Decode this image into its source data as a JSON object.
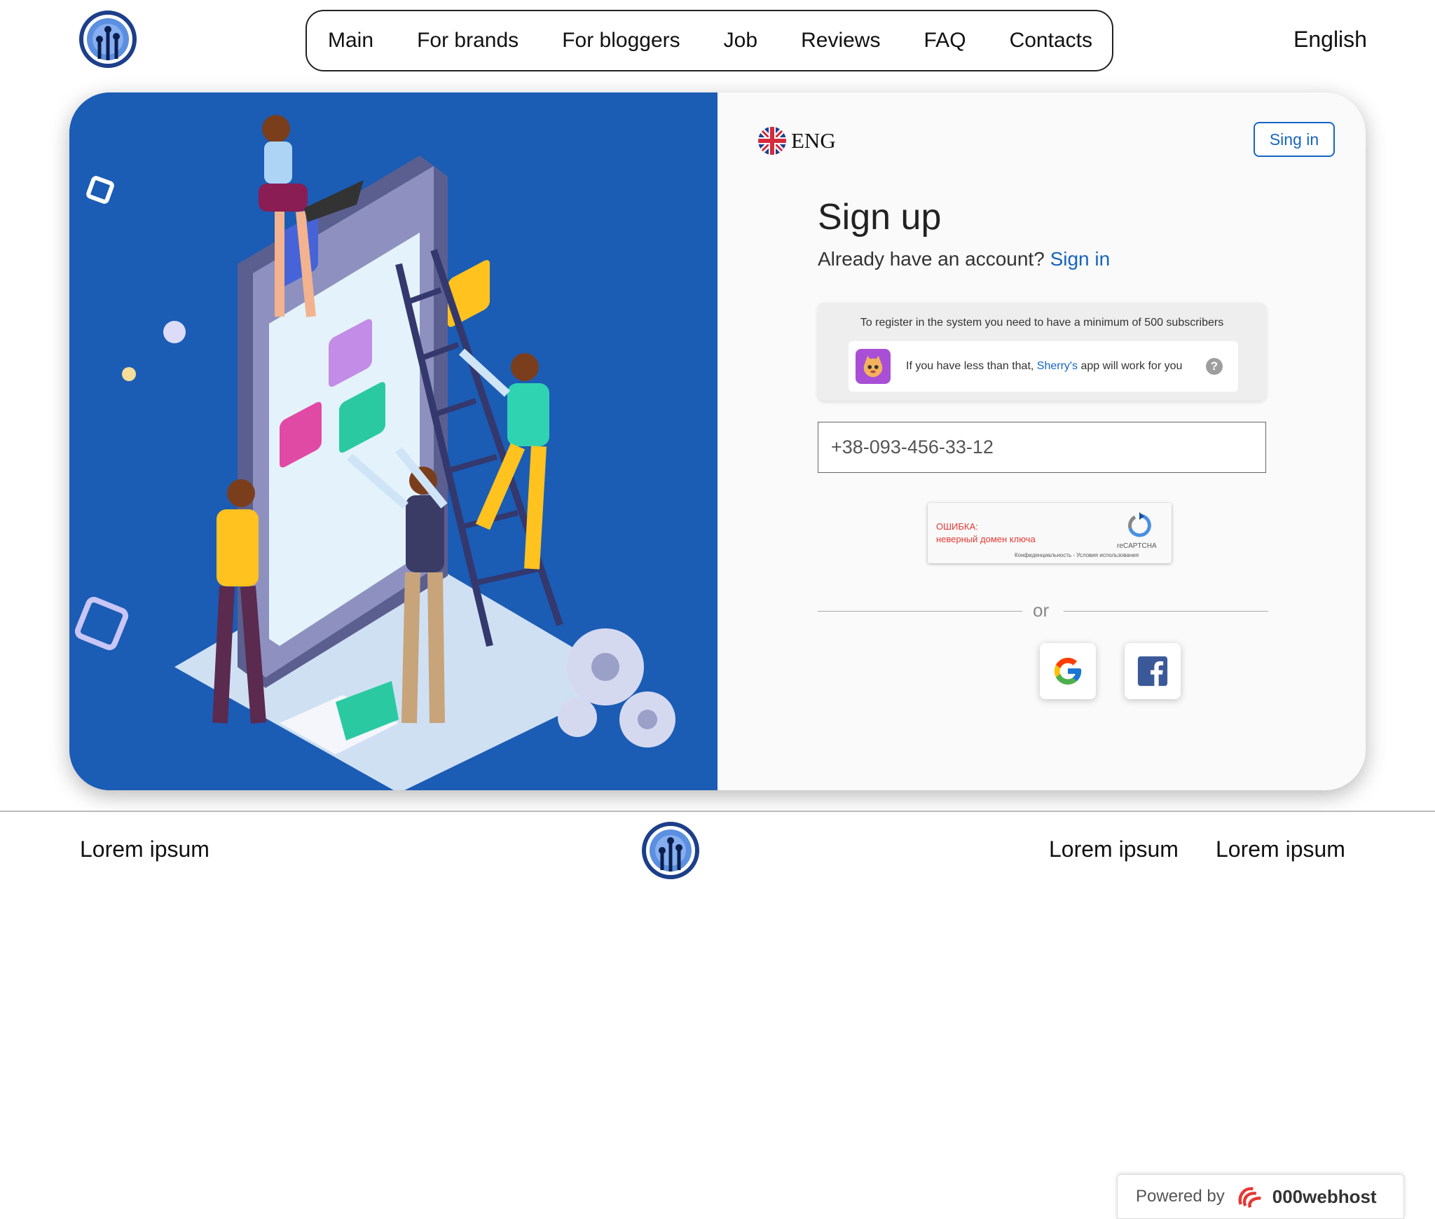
{
  "nav": {
    "items": [
      "Main",
      "For brands",
      "For bloggers",
      "Job",
      "Reviews",
      "FAQ",
      "Contacts"
    ],
    "language": "English"
  },
  "signup": {
    "lang_code": "ENG",
    "signin_button": "Sing in",
    "title": "Sign up",
    "already_text": "Already have an account?",
    "signin_link": "Sign in",
    "notice_requirement": "To register in the system you need to have a minimum of 500 subscribers",
    "notice_prefix": "If you have less than that,",
    "notice_link": "Sherry's",
    "notice_suffix": "app will work for you",
    "phone_placeholder": "+38-093-456-33-12",
    "captcha_error_title": "ОШИБКА:",
    "captcha_error_text": "неверный домен ключа",
    "captcha_brand": "reCAPTCHA",
    "captcha_terms": "Конфиденциальность - Условия использования",
    "or_text": "or"
  },
  "footer": {
    "left": "Lorem ipsum",
    "right1": "Lorem ipsum",
    "right2": "Lorem ipsum",
    "powered_by": "Powered by",
    "host_name": "000webhost"
  },
  "colors": {
    "accent": "#1565c0",
    "illustration_bg": "#1b5cb5"
  }
}
